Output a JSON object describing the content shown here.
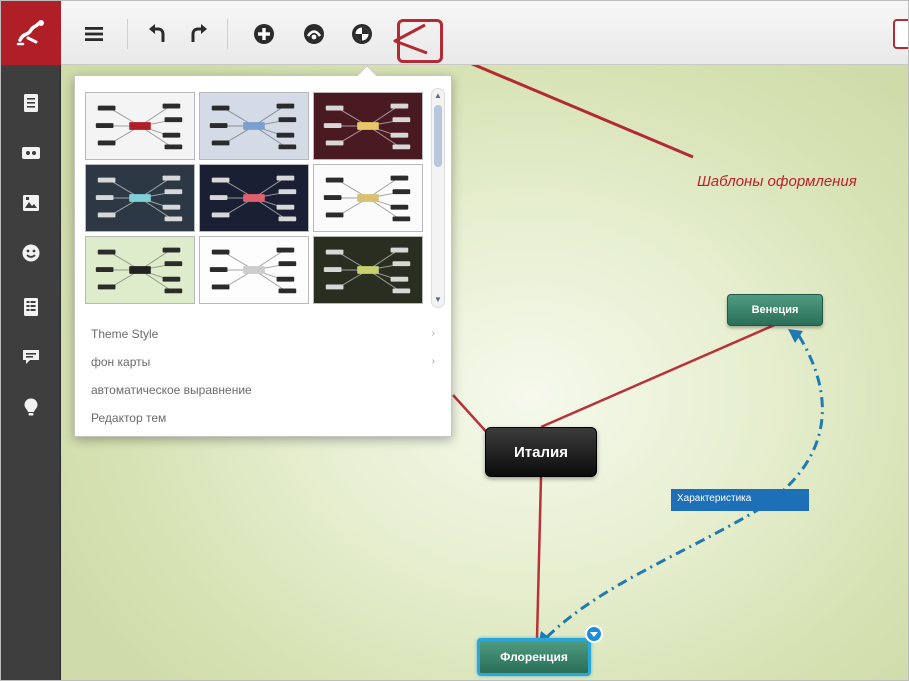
{
  "toolbar": {
    "buttons": [
      {
        "name": "menu-icon",
        "icon": "hamburger"
      },
      {
        "name": "undo-icon",
        "icon": "undo-arrow"
      },
      {
        "name": "redo-icon",
        "icon": "redo-arrow"
      },
      {
        "name": "add-icon",
        "icon": "plus-circle"
      },
      {
        "name": "palette-icon",
        "icon": "palette-circle"
      },
      {
        "name": "theme-icon",
        "icon": "theme-globe"
      }
    ]
  },
  "sidebar": {
    "items": [
      {
        "name": "outline-icon",
        "icon": "document"
      },
      {
        "name": "label-icon",
        "icon": "tag-card"
      },
      {
        "name": "image-icon",
        "icon": "picture"
      },
      {
        "name": "smiley-icon",
        "icon": "emoji"
      },
      {
        "name": "notes-icon",
        "icon": "list-document"
      },
      {
        "name": "comment-icon",
        "icon": "speech-bubble"
      },
      {
        "name": "idea-icon",
        "icon": "lightbulb"
      }
    ]
  },
  "theme_popup": {
    "thumbnails": [
      {
        "name": "theme-light-gray",
        "bg": "#f4f4f4",
        "node": "#b01e28"
      },
      {
        "name": "theme-blue-gray",
        "bg": "#d4dbe6",
        "node": "#7aa0d0"
      },
      {
        "name": "theme-maroon",
        "bg": "#4a1a22",
        "node": "#e8c76a"
      },
      {
        "name": "theme-dark-slate",
        "bg": "#2c3944",
        "node": "#7fd0d8"
      },
      {
        "name": "theme-navy",
        "bg": "#1a1f33",
        "node": "#e06070"
      },
      {
        "name": "theme-white-radial",
        "bg": "#fbfbfb",
        "node": "#d8c070"
      },
      {
        "name": "theme-green-light",
        "bg": "#dfeccc",
        "node": "#222222"
      },
      {
        "name": "theme-white-sketch",
        "bg": "#fdfdfd",
        "node": "#cccccc"
      },
      {
        "name": "theme-dark-olive",
        "bg": "#2a2e20",
        "node": "#c8d070"
      }
    ],
    "menu": [
      {
        "label": "Theme Style",
        "has_submenu": true
      },
      {
        "label": "фон карты",
        "has_submenu": true
      },
      {
        "label": "автоматическое выравнение",
        "has_submenu": false
      },
      {
        "label": "Редактор тем",
        "has_submenu": false
      }
    ]
  },
  "map": {
    "central_node": "Италия",
    "nodes": [
      "Венеция",
      "Флоренция"
    ],
    "link_label": "Характеристика"
  },
  "annotation": "Шаблоны оформления",
  "colors": {
    "brand": "#b01e28",
    "branch": "#b8323a",
    "relation": "#1e7ab0",
    "node_green": "#3a8a6e",
    "annotation": "#c0202a"
  }
}
